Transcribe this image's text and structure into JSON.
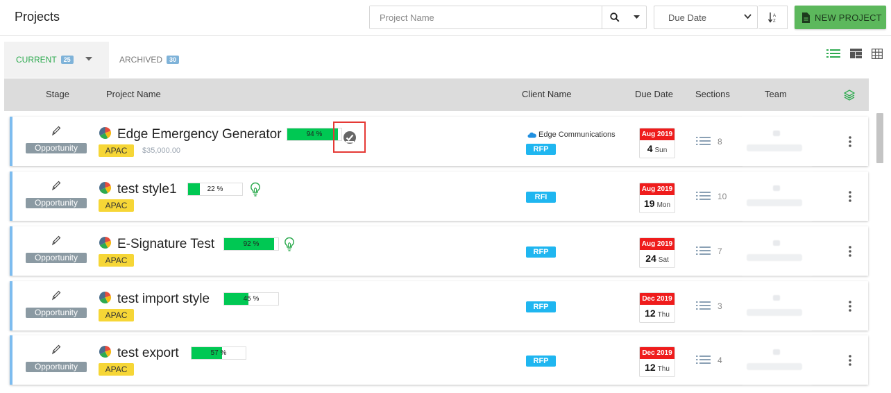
{
  "header": {
    "title": "Projects",
    "search_placeholder": "Project Name",
    "sort_field": "Due Date",
    "new_button_label": "NEW PROJECT"
  },
  "tabs": [
    {
      "label": "CURRENT",
      "count": "25"
    },
    {
      "label": "ARCHIVED",
      "count": "30"
    }
  ],
  "columns": {
    "stage": "Stage",
    "project_name": "Project Name",
    "client_name": "Client Name",
    "due_date": "Due Date",
    "sections": "Sections",
    "team": "Team"
  },
  "rows": [
    {
      "stage": "Opportunity",
      "name": "Edge Emergency Generator",
      "progress_pct": 94,
      "progress_label": "94 %",
      "region": "APAC",
      "amount": "$35,000.00",
      "client": "Edge Communications",
      "doc_type": "RFP",
      "due_month": "Aug 2019",
      "due_day": "4",
      "due_weekday": "Sun",
      "sections": "8",
      "icon": "check-badge-icon"
    },
    {
      "stage": "Opportunity",
      "name": "test style1",
      "progress_pct": 22,
      "progress_label": "22 %",
      "region": "APAC",
      "amount": "",
      "client": "",
      "doc_type": "RFI",
      "due_month": "Aug 2019",
      "due_day": "19",
      "due_weekday": "Mon",
      "sections": "10",
      "icon": "lightbulb-icon"
    },
    {
      "stage": "Opportunity",
      "name": "E-Signature Test",
      "progress_pct": 92,
      "progress_label": "92 %",
      "region": "APAC",
      "amount": "",
      "client": "",
      "doc_type": "RFP",
      "due_month": "Aug 2019",
      "due_day": "24",
      "due_weekday": "Sat",
      "sections": "7",
      "icon": "lightbulb-icon"
    },
    {
      "stage": "Opportunity",
      "name": "test import style",
      "progress_pct": 45,
      "progress_label": "45 %",
      "region": "APAC",
      "amount": "",
      "client": "",
      "doc_type": "RFP",
      "due_month": "Dec 2019",
      "due_day": "12",
      "due_weekday": "Thu",
      "sections": "3",
      "icon": ""
    },
    {
      "stage": "Opportunity",
      "name": "test export",
      "progress_pct": 57,
      "progress_label": "57 %",
      "region": "APAC",
      "amount": "",
      "client": "",
      "doc_type": "RFP",
      "due_month": "Dec 2019",
      "due_day": "12",
      "due_weekday": "Thu",
      "sections": "4",
      "icon": ""
    }
  ],
  "colors": {
    "accent_green": "#2daa4f",
    "progress_green": "#00c853",
    "due_red": "#ef1c1c",
    "doc_blue": "#1fb6f0",
    "region_yellow": "#f6d636"
  }
}
